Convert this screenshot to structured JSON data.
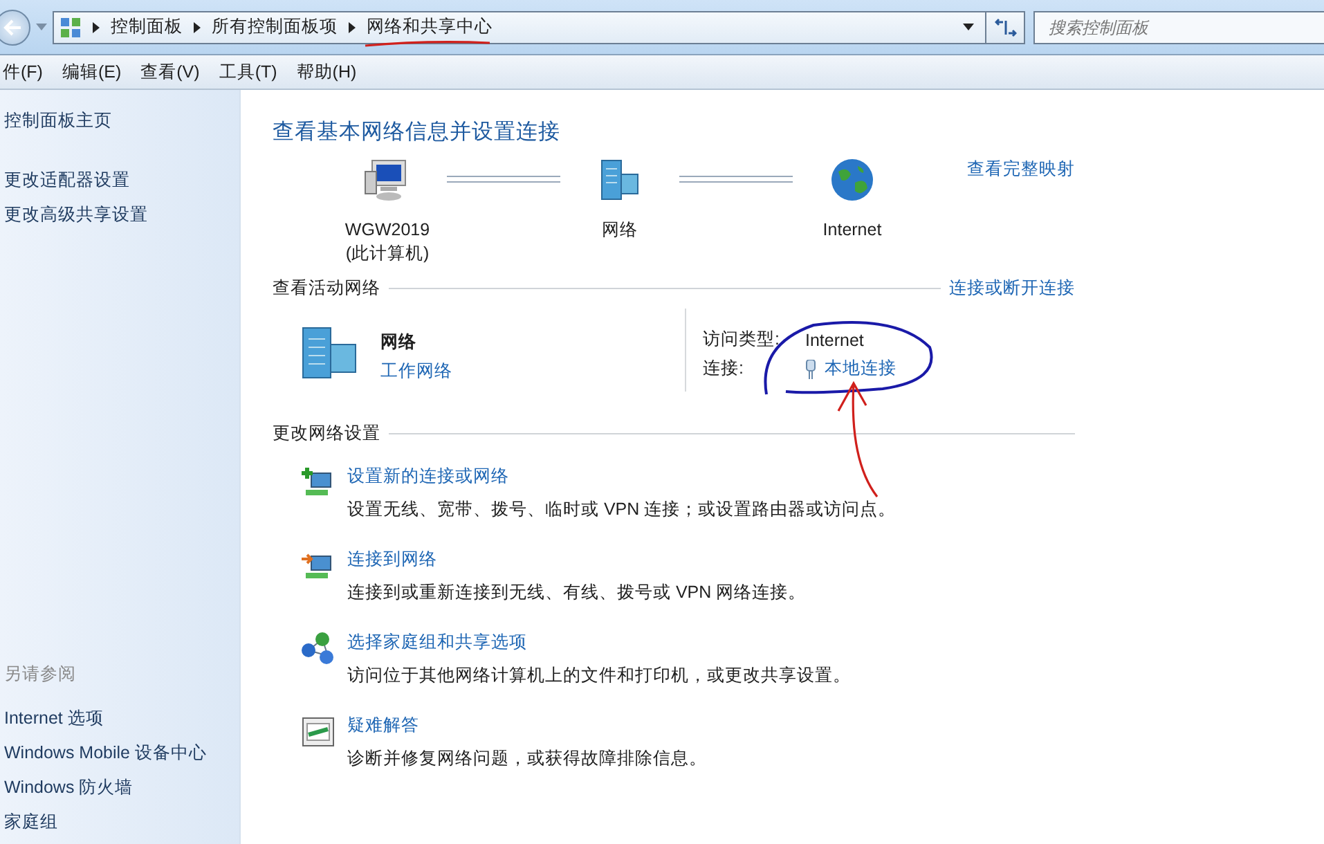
{
  "address_bar": {
    "breadcrumbs": [
      {
        "label": "控制面板"
      },
      {
        "label": "所有控制面板项"
      },
      {
        "label": "网络和共享中心"
      }
    ],
    "search": {
      "placeholder": "搜索控制面板"
    }
  },
  "menu_bar": [
    "件(F)",
    "编辑(E)",
    "查看(V)",
    "工具(T)",
    "帮助(H)"
  ],
  "sidebar": {
    "links": [
      "控制面板主页",
      "更改适配器设置",
      "更改高级共享设置"
    ],
    "see_also_title": "另请参阅",
    "see_also": [
      "Internet 选项",
      "Windows Mobile 设备中心",
      "Windows 防火墙",
      "家庭组"
    ]
  },
  "main": {
    "title": "查看基本网络信息并设置连接",
    "map": {
      "nodes": [
        {
          "kind": "computer",
          "label": "WGW2019",
          "sublabel": "(此计算机)"
        },
        {
          "kind": "network",
          "label": "网络"
        },
        {
          "kind": "internet",
          "label": "Internet"
        }
      ],
      "full_map_link": "查看完整映射"
    },
    "active": {
      "heading": "查看活动网络",
      "action_link": "连接或断开连接",
      "network_name": "网络",
      "network_type": "工作网络",
      "access_label": "访问类型:",
      "access_value": "Internet",
      "connection_label": "连接:",
      "connection_value": "本地连接"
    },
    "change": {
      "heading": "更改网络设置",
      "tasks": [
        {
          "kind": "new_connection",
          "title": "设置新的连接或网络",
          "description": "设置无线、宽带、拨号、临时或 VPN 连接；或设置路由器或访问点。"
        },
        {
          "kind": "connect",
          "title": "连接到网络",
          "description": "连接到或重新连接到无线、有线、拨号或 VPN 网络连接。"
        },
        {
          "kind": "homegroup",
          "title": "选择家庭组和共享选项",
          "description": "访问位于其他网络计算机上的文件和打印机，或更改共享设置。"
        },
        {
          "kind": "troubleshoot",
          "title": "疑难解答",
          "description": "诊断并修复网络问题，或获得故障排除信息。"
        }
      ]
    }
  }
}
